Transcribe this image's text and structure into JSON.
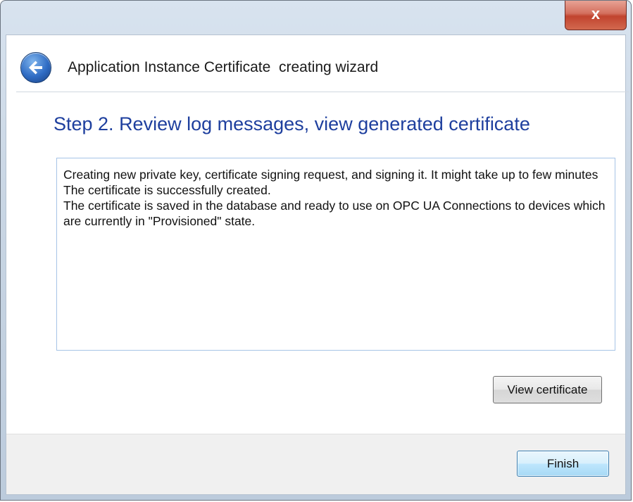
{
  "window": {
    "close_glyph": "x",
    "close_icon": "close-icon"
  },
  "header": {
    "back_icon": "back-arrow-icon",
    "title": "Application Instance Certificate  creating wizard"
  },
  "content": {
    "step_title": "Step 2. Review log messages, view generated certificate",
    "log_lines": [
      "Creating new private key, certificate signing request, and signing it. It might take up to few minutes",
      "The certificate is successfully created.",
      "The certificate is saved in the database and ready to use on OPC UA Connections to devices which are currently in \"Provisioned\" state."
    ],
    "view_certificate_label": "View certificate"
  },
  "footer": {
    "finish_label": "Finish"
  },
  "colors": {
    "step_title": "#1e3f9e",
    "close_button": "#c1432e",
    "finish_button": "#bee6fd"
  }
}
